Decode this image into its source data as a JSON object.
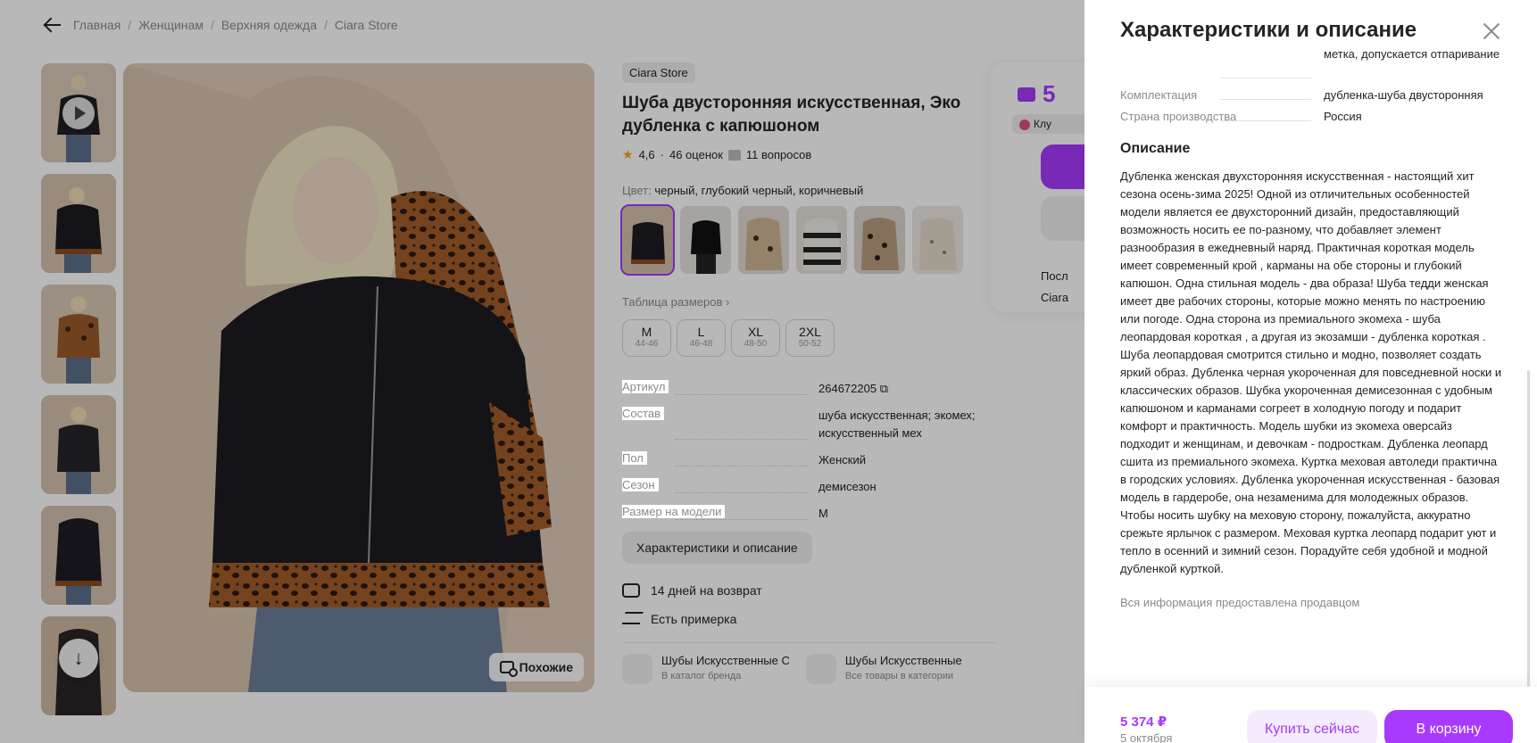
{
  "breadcrumb": {
    "items": [
      "Главная",
      "Женщинам",
      "Верхняя одежда",
      "Ciara Store"
    ],
    "sep": "/"
  },
  "gallery": {
    "similar_label": "Похожие"
  },
  "product": {
    "brand": "Ciara Store",
    "title": "Шуба двусторонняя искусственная, Эко дубленка с капюшоном",
    "rating": "4,6",
    "reviews": "46 оценок",
    "questions": "11 вопросов",
    "color_label": "Цвет:",
    "color_value": "черный, глубокий черный, коричневый",
    "size_table": "Таблица размеров",
    "sizes": [
      {
        "name": "M",
        "range": "44-46"
      },
      {
        "name": "L",
        "range": "46-48"
      },
      {
        "name": "XL",
        "range": "48-50"
      },
      {
        "name": "2XL",
        "range": "50-52"
      }
    ],
    "specs": [
      {
        "k": "Артикул",
        "v": "264672205"
      },
      {
        "k": "Состав",
        "v": "шуба искусственная; экомех; искусственный мех"
      },
      {
        "k": "Пол",
        "v": "Женский"
      },
      {
        "k": "Сезон",
        "v": "демисезон"
      },
      {
        "k": "Размер на модели",
        "v": "M"
      }
    ],
    "char_button": "Характеристики и описание",
    "return_label": "14 дней на возврат",
    "fitting_label": "Есть примерка",
    "cats": [
      {
        "t1": "Шубы Искусственные С",
        "t2": "В каталог бренда"
      },
      {
        "t1": "Шубы Искусственные",
        "t2": "Все товары в категории"
      }
    ]
  },
  "buy_card": {
    "price_partial": "5",
    "club_partial": "Клу",
    "line1": "Посл",
    "line2": "Ciara"
  },
  "panel": {
    "title": "Характеристики и описание",
    "rows": [
      {
        "k": "",
        "v": "метка, допускается отпаривание"
      },
      {
        "k": "Комплектация",
        "v": "дубленка-шуба двусторонняя"
      },
      {
        "k": "Страна производства",
        "v": "Россия"
      }
    ],
    "desc_title": "Описание",
    "description": "Дубленка женская двухсторонняя искусственная - настоящий хит сезона осень-зима 2025! Одной из отличительных особенностей модели является ее двухсторонний дизайн, предоставляющий возможность носить ее по-разному, что добавляет элемент разнообразия в ежедневный наряд. Практичная короткая модель имеет современный крой , карманы на обе стороны и глубокий капюшон. Одна стильная модель - два образа! Шуба тедди женская имеет две рабочих стороны, которые можно менять по настроению или погоде. Одна сторона из премиального экомеха - шуба леопардовая короткая , а другая из экозамши - дубленка короткая . Шуба леопардовая смотрится стильно и модно, позволяет создать яркий образ. Дубленка черная укороченная для повседневной носки и классических образов. Шубка укороченная демисезонная с удобным капюшоном и карманами согреет в холодную погоду и подарит комфорт и практичность. Модель шубки из экомеха оверсайз подходит и женщинам, и девочкам - подросткам. Дубленка леопард сшита из премиального экомеха. Куртка меховая автоледи практична в городских условиях. Дубленка укороченная искусственная - базовая модель в гардеробе, она незаменима для молодежных образов. Чтобы носить шубку на меховую сторону, пожалуйста, аккуратно срежьте ярлычок с размером. Меховая куртка леопард подарит уют и тепло в осенний и зимний сезон. Порадуйте себя удобной и модной дубленкой курткой.",
    "seller_note": "Вся информация предоставлена продавцом"
  },
  "footer": {
    "price": "5 374 ₽",
    "date": "5 октября",
    "buy_now": "Купить сейчас",
    "cart": "В корзину"
  },
  "colors": {
    "accent": "#a73afd",
    "overlay": "rgba(0,0,0,0.28)"
  }
}
